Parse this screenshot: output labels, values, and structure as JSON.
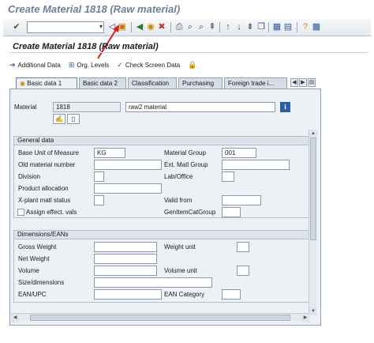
{
  "window": {
    "title": "Create Material 1818 (Raw material)"
  },
  "toolbar": {
    "command_field": ""
  },
  "screen": {
    "title": "Create Material 1818 (Raw material)"
  },
  "app_toolbar": {
    "additional_data": "Additional Data",
    "org_levels": "Org. Levels",
    "check_screen_data": "Check Screen Data"
  },
  "tabs": [
    "Basic data 1",
    "Basic data 2",
    "Classification",
    "Purchasing",
    "Foreign trade i..."
  ],
  "material": {
    "label": "Material",
    "number": "1818",
    "description": "raw2 material"
  },
  "general": {
    "header": "General data",
    "base_uom_label": "Base Unit of Measure",
    "base_uom_value": "KG",
    "old_material_label": "Old material number",
    "division_label": "Division",
    "product_allocation_label": "Product allocation",
    "xplant_status_label": "X-plant matl status",
    "assign_effect_label": "Assign effect. vals",
    "material_group_label": "Material Group",
    "material_group_value": "001",
    "ext_matl_group_label": "Ext. Matl Group",
    "lab_office_label": "Lab/Office",
    "valid_from_label": "Valid from",
    "gen_item_cat_label": "GenItemCatGroup"
  },
  "dimensions": {
    "header": "Dimensions/EANs",
    "gross_weight_label": "Gross Weight",
    "net_weight_label": "Net Weight",
    "volume_label": "Volume",
    "size_dimensions_label": "Size/dimensions",
    "ean_upc_label": "EAN/UPC",
    "weight_unit_label": "Weight unit",
    "volume_unit_label": "Volume unit",
    "ean_category_label": "EAN Category"
  }
}
